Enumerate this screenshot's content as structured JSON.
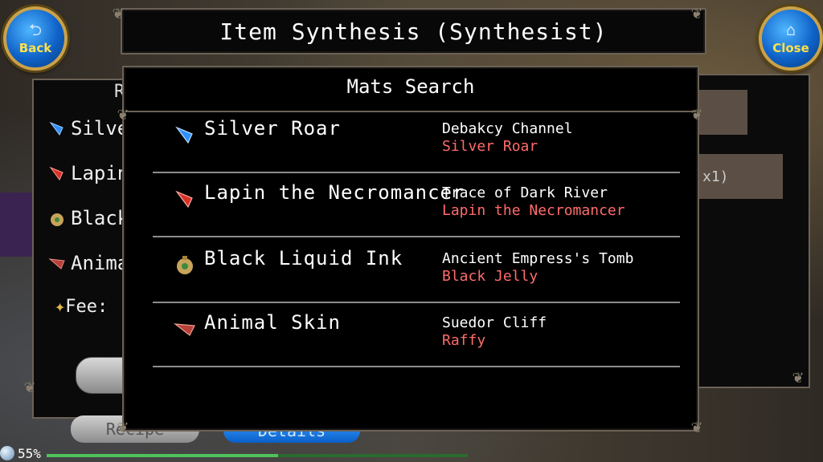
{
  "header": {
    "title": "Item Synthesis (Synthesist)",
    "back_label": "Back",
    "close_label": "Close"
  },
  "recipe_panel": {
    "header_fragment": "R",
    "items": [
      {
        "label": "Silve",
        "icon": "blue-gem-icon"
      },
      {
        "label": "Lapin",
        "icon": "red-gem-icon"
      },
      {
        "label": "Black",
        "icon": "ink-bag-icon"
      },
      {
        "label": "Anima",
        "icon": "skin-icon"
      }
    ],
    "fee_label": "Fee:",
    "recipe_tab": "Recipe",
    "details_tab": "Details"
  },
  "right_panel": {
    "count_fragment": "x1)"
  },
  "mats_search": {
    "title": "Mats Search",
    "rows": [
      {
        "name": "Silver Roar",
        "location": "Debakcy Channel",
        "monster": "Silver Roar",
        "icon": "blue-gem-icon"
      },
      {
        "name": "Lapin the Necromancer",
        "location": "Trace of Dark River",
        "monster": "Lapin the Necromancer",
        "icon": "red-gem-icon"
      },
      {
        "name": "Black Liquid Ink",
        "location": "Ancient Empress's Tomb",
        "monster": "Black Jelly",
        "icon": "ink-bag-icon"
      },
      {
        "name": "Animal Skin",
        "location": "Suedor Cliff",
        "monster": "Raffy",
        "icon": "skin-icon"
      }
    ]
  },
  "status": {
    "percent_label": "55%",
    "progress_fraction": 0.55
  },
  "colors": {
    "monster_text": "#ff6b6b",
    "panel_border": "#6b6256",
    "button_gold": "#ffe14a"
  }
}
